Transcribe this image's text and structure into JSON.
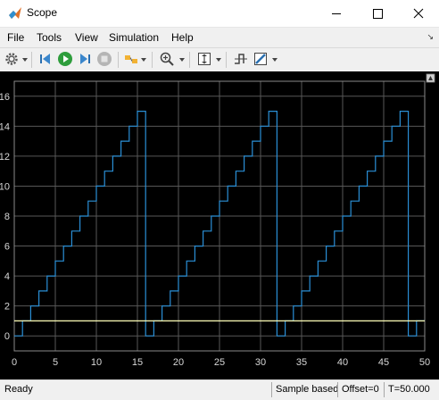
{
  "window": {
    "title": "Scope",
    "icon": "matlab-icon",
    "controls": [
      "minimize-icon",
      "maximize-icon",
      "close-icon"
    ]
  },
  "menu": {
    "items": [
      "File",
      "Tools",
      "View",
      "Simulation",
      "Help"
    ],
    "pin_icon": "undock-arrow-icon"
  },
  "toolbar": {
    "buttons": [
      "settings-icon",
      "step-back-icon",
      "run-icon",
      "step-forward-icon",
      "stop-icon",
      "highlight-icon",
      "zoom-in-icon",
      "scale-axes-icon",
      "triggers-icon",
      "style-icon"
    ]
  },
  "colors": {
    "plot_background": "#000000",
    "grid": "#575757",
    "axis_text": "#d8d8d8",
    "signal_1": "#2a8fd6",
    "signal_2": "#ffffb8"
  },
  "chart_data": {
    "type": "line",
    "title": "",
    "xlabel": "",
    "ylabel": "",
    "xlim": [
      0,
      50
    ],
    "ylim": [
      -1,
      17
    ],
    "x_ticks": [
      "0",
      "5",
      "10",
      "15",
      "20",
      "25",
      "30",
      "35",
      "40",
      "45",
      "50"
    ],
    "y_ticks": [
      "0",
      "2",
      "4",
      "6",
      "8",
      "10",
      "12",
      "14",
      "16"
    ],
    "grid": true,
    "series": [
      {
        "style": "stairs",
        "color": "#2a8fd6",
        "x": [
          0,
          1,
          2,
          3,
          4,
          5,
          6,
          7,
          8,
          9,
          10,
          11,
          12,
          13,
          14,
          15,
          16,
          17,
          18,
          19,
          20,
          21,
          22,
          23,
          24,
          25,
          26,
          27,
          28,
          29,
          30,
          31,
          32,
          33,
          34,
          35,
          36,
          37,
          38,
          39,
          40,
          41,
          42,
          43,
          44,
          45,
          46,
          47,
          48,
          49,
          50
        ],
        "y": [
          0,
          1,
          2,
          3,
          4,
          5,
          6,
          7,
          8,
          9,
          10,
          11,
          12,
          13,
          14,
          15,
          0,
          1,
          2,
          3,
          4,
          5,
          6,
          7,
          8,
          9,
          10,
          11,
          12,
          13,
          14,
          15,
          0,
          1,
          2,
          3,
          4,
          5,
          6,
          7,
          8,
          9,
          10,
          11,
          12,
          13,
          14,
          15,
          0,
          1,
          1
        ]
      },
      {
        "style": "line",
        "color": "#ffffb8",
        "x": [
          0,
          50
        ],
        "y": [
          1,
          1
        ]
      }
    ]
  },
  "status": {
    "text": "Ready",
    "mode": "Sample based",
    "offset": "Offset=0",
    "time": "T=50.000"
  }
}
